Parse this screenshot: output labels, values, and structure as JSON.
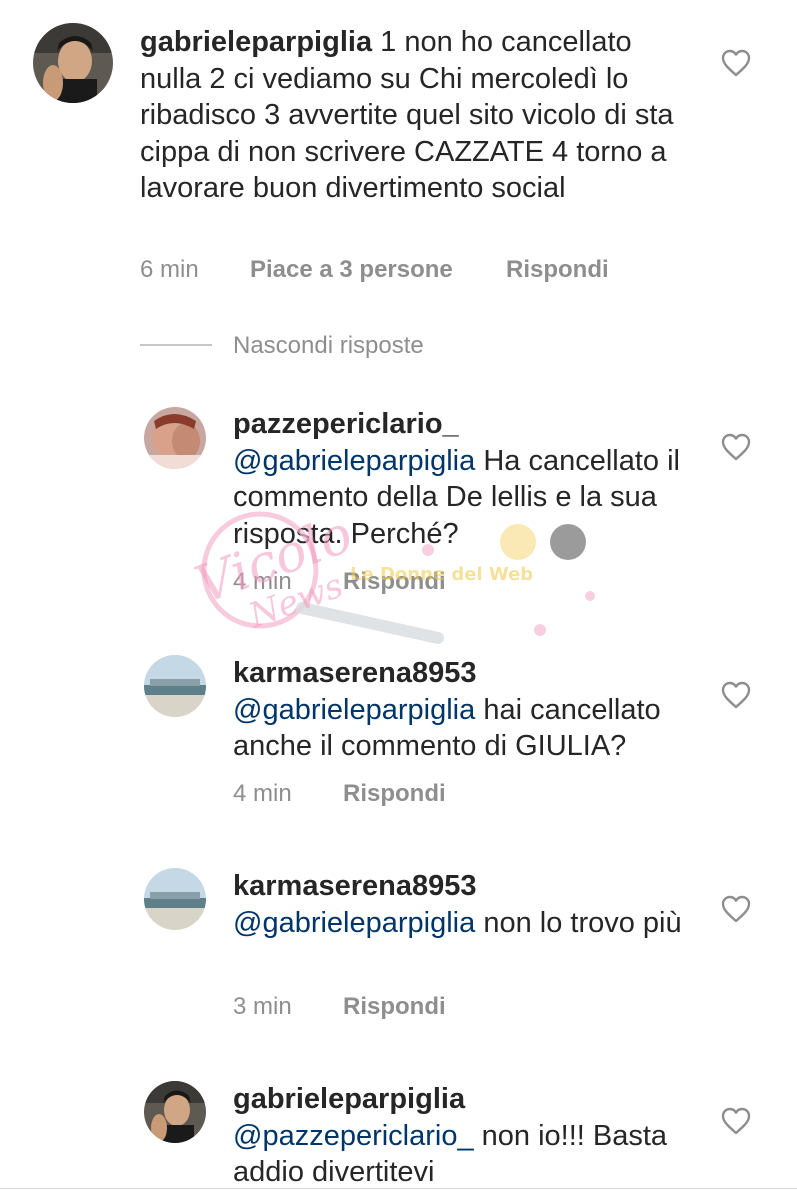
{
  "comments": [
    {
      "username": "gabrieleparpiglia",
      "mention": "",
      "text": " 1 non ho cancellato nulla 2 ci vediamo su Chi mercoledì lo ribadisco 3 avvertite quel sito vicolo di sta cippa di non scrivere CAZZATE 4 torno a lavorare buon divertimento social",
      "time": "6 min",
      "likes": "Piace a 3 persone",
      "reply": "Rispondi"
    },
    {
      "username": "pazzepericlario_",
      "mention": "@gabrieleparpiglia",
      "text": " Ha cancellato il commento della De lellis e la sua risposta. Perché?",
      "time": "4 min",
      "reply": "Rispondi"
    },
    {
      "username": "karmaserena8953",
      "mention": "@gabrieleparpiglia",
      "text": " hai cancellato anche il commento di GIULIA?",
      "time": "4 min",
      "reply": "Rispondi"
    },
    {
      "username": "karmaserena8953",
      "mention": "@gabrieleparpiglia",
      "text": " non lo trovo più",
      "time": "3 min",
      "reply": "Rispondi"
    },
    {
      "username": "gabrieleparpiglia",
      "mention": "@pazzepericlario_",
      "text": " non io!!! Basta addio divertitevi"
    }
  ],
  "hide_replies": "Nascondi risposte",
  "watermark": {
    "brand": "Vicolo delle News",
    "tagline": "Le Donne del Web"
  },
  "colors": {
    "text": "#262626",
    "meta": "#8e8e8e",
    "mention": "#003569"
  }
}
